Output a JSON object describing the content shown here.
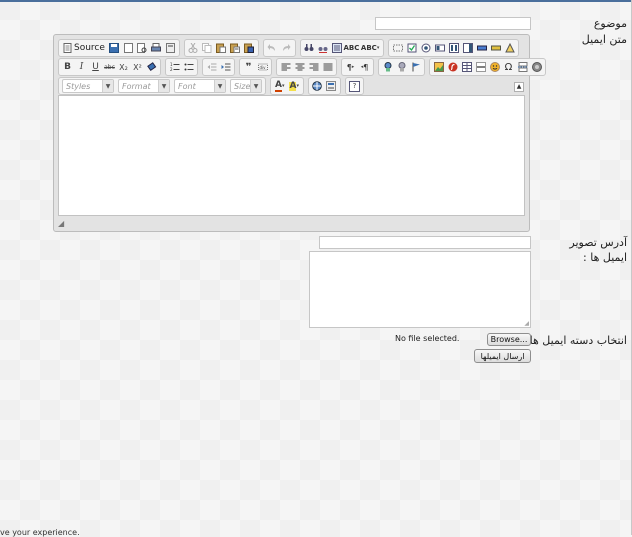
{
  "form": {
    "subject_label": "موضوع",
    "email_body_label": "متن ایمیل",
    "image_address_label": "آدرس تصویر",
    "emails_label": "ایمیل ها :",
    "email_file_label": "انتخاب دسته ایمیل ها :",
    "file_status": "No file selected.",
    "browse_label": "Browse...",
    "send_label": "ارسال ایمیلها"
  },
  "editor": {
    "source_label": "Source",
    "styles_placeholder": "Styles",
    "format_placeholder": "Format",
    "font_placeholder": "Font",
    "size_placeholder": "Size",
    "bold": "B",
    "italic": "I",
    "underline": "U",
    "strike": "abc",
    "subscript": "X₂",
    "superscript": "X²",
    "text_color": "A",
    "bg_color": "A",
    "help": "?"
  },
  "footer": {
    "notice": "ve your experience."
  },
  "colors": {
    "accent": "#4a6f9c",
    "text_color_icon": "#d04000",
    "bg_color_icon": "#e8c000"
  }
}
